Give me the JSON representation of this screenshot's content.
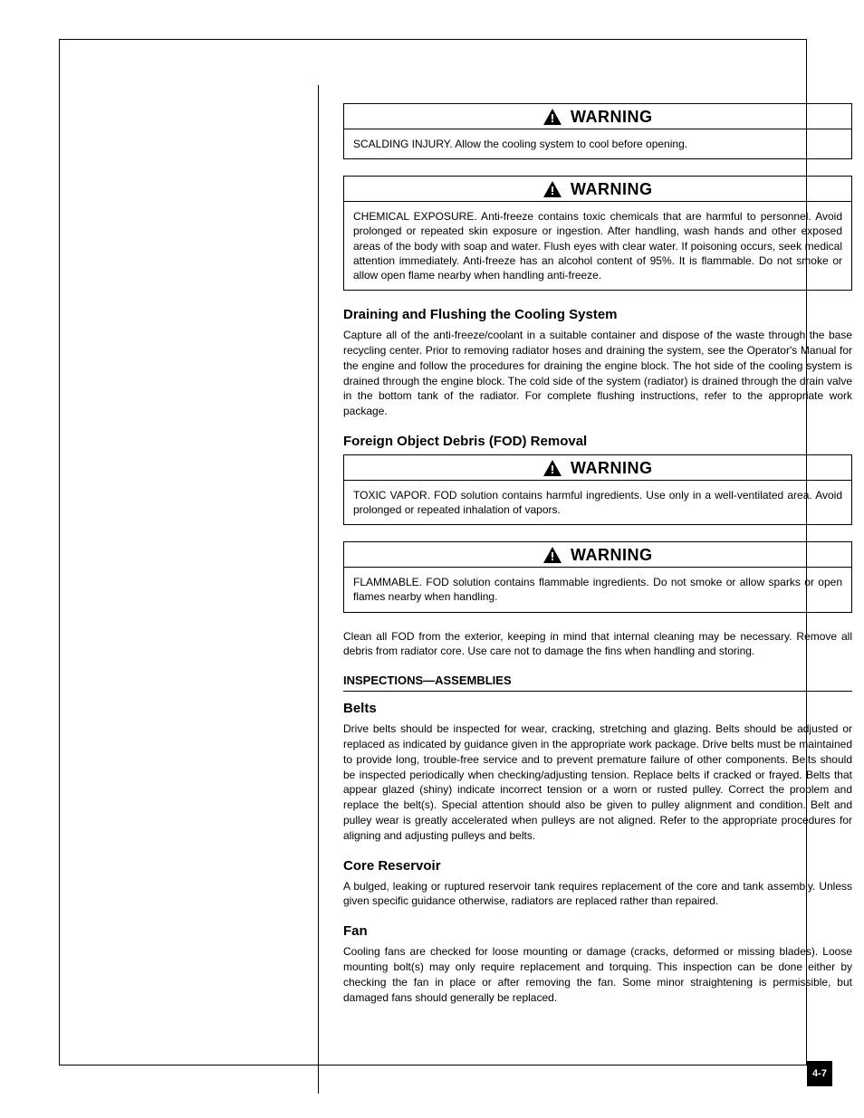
{
  "page_number": "4-7",
  "alerts": {
    "scalding": {
      "label": "WARNING",
      "text": "SCALDING INJURY. Allow the cooling system to cool before opening."
    },
    "chemical": {
      "label": "WARNING",
      "text": "CHEMICAL EXPOSURE. Anti-freeze contains toxic chemicals that are harmful to personnel. Avoid prolonged or repeated skin exposure or ingestion. After handling, wash hands and other exposed areas of the body with soap and water. Flush eyes with clear water. If poisoning occurs, seek medical attention immediately. Anti-freeze has an alcohol content of 95%. It is flammable. Do not smoke or allow open flame nearby when handling anti-freeze."
    },
    "toxic": {
      "label": "WARNING",
      "text": "TOXIC VAPOR. FOD solution contains harmful ingredients. Use only in a well-ventilated area. Avoid prolonged or repeated inhalation of vapors."
    },
    "flammable": {
      "label": "WARNING",
      "text": "FLAMMABLE. FOD solution contains flammable ingredients. Do not smoke or allow sparks or open flames nearby when handling."
    }
  },
  "sections": {
    "s1_title": "Draining and Flushing the Cooling System",
    "s1_text": "Capture all of the anti-freeze/coolant in a suitable container and dispose of the waste through the base recycling center. Prior to removing radiator hoses and draining the system, see the Operator's Manual for the engine and follow the procedures for draining the engine block. The hot side of the cooling system is drained through the engine block. The cold side of the system (radiator) is drained through the drain valve in the bottom tank of the radiator. For complete flushing instructions, refer to the appropriate work package.",
    "s2_title": "Foreign Object Debris (FOD) Removal",
    "s2_text": "Clean all FOD from the exterior, keeping in mind that internal cleaning may be necessary. Remove all debris from radiator core. Use care not to damage the fins when handling and storing.",
    "sub_heading": "INSPECTIONS—ASSEMBLIES",
    "s3_title": "Belts",
    "s3_text": "Drive belts should be inspected for wear, cracking, stretching and glazing. Belts should be adjusted or replaced as indicated by guidance given in the appropriate work package. Drive belts must be maintained to provide long, trouble-free service and to prevent premature failure of other components. Belts should be inspected periodically when checking/adjusting tension. Replace belts if cracked or frayed. Belts that appear glazed (shiny) indicate incorrect tension or a worn or rusted pulley. Correct the problem and replace the belt(s). Special attention should also be given to pulley alignment and condition. Belt and pulley wear is greatly accelerated when pulleys are not aligned. Refer to the appropriate procedures for aligning and adjusting pulleys and belts.",
    "s4_title": "Core Reservoir",
    "s4_text": "A bulged, leaking or ruptured reservoir tank requires replacement of the core and tank assembly. Unless given specific guidance otherwise, radiators are replaced rather than repaired.",
    "s5_title": "Fan",
    "s5_text": "Cooling fans are checked for loose mounting or damage (cracks, deformed or missing blades). Loose mounting bolt(s) may only require replacement and torquing. This inspection can be done either by checking the fan in place or after removing the fan. Some minor straightening is permissible, but damaged fans should generally be replaced."
  }
}
